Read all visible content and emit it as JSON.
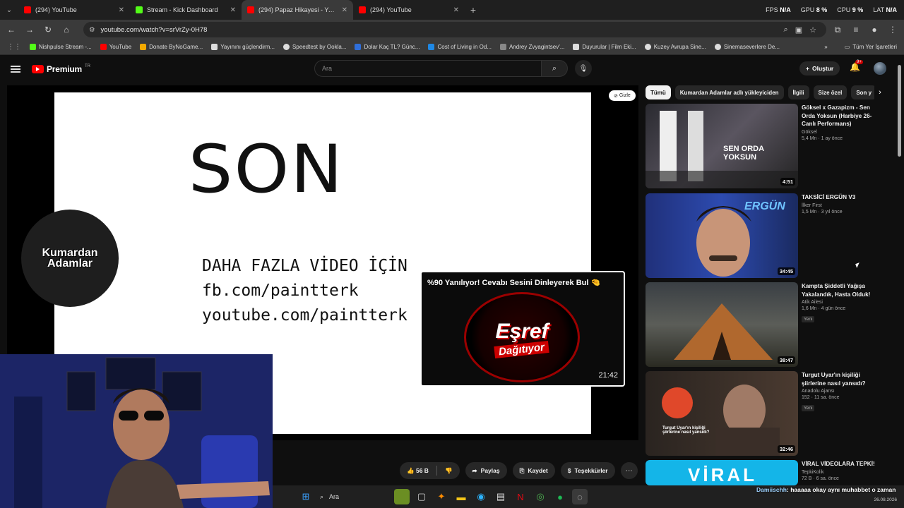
{
  "browser": {
    "tabs": [
      {
        "title": "(294) YouTube",
        "icon": "youtube-icon",
        "color": "#ff0000"
      },
      {
        "title": "Stream - Kick Dashboard",
        "icon": "kick-icon",
        "color": "#53fc18"
      },
      {
        "title": "(294) Papaz Hikayesi - YouTube",
        "icon": "youtube-icon",
        "color": "#ff0000",
        "active": true
      },
      {
        "title": "(294) YouTube",
        "icon": "youtube-icon",
        "color": "#ff0000"
      }
    ],
    "stats": {
      "fps_label": "FPS",
      "fps_value": "N/A",
      "gpu_label": "GPU",
      "gpu_value": "8 %",
      "cpu_label": "CPU",
      "cpu_value": "9 %",
      "lat_label": "LAT",
      "lat_value": "N/A"
    },
    "url": "youtube.com/watch?v=srVrZy-0H78",
    "bookmarks": [
      {
        "label": "Nishpulse Stream -...",
        "color": "#53fc18"
      },
      {
        "label": "YouTube",
        "color": "#ff0000"
      },
      {
        "label": "Donate ByNoGame...",
        "color": "#f2a900"
      },
      {
        "label": "Yayınını güçlendirm...",
        "color": "#dddddd"
      },
      {
        "label": "Speedtest by Ookla...",
        "color": "#dddddd"
      },
      {
        "label": "Dolar Kaç TL? Günc...",
        "color": "#2f6fdb"
      },
      {
        "label": "Cost of Living in Od...",
        "color": "#1e88e5"
      },
      {
        "label": "Andrey Zvyagintsev'...",
        "color": "#888888"
      },
      {
        "label": "Duyurular | Film Eki...",
        "color": "#dddddd"
      },
      {
        "label": "Kuzey Avrupa Sine...",
        "color": "#dddddd"
      },
      {
        "label": "Sinemaseverlere De...",
        "color": "#dddddd"
      }
    ],
    "all_bookmarks": "Tüm Yer İşaretleri"
  },
  "youtube": {
    "logo_text": "Premium",
    "logo_sup": "TR",
    "search_placeholder": "Ara",
    "create_label": "Oluştur",
    "notif_count": "9+",
    "gizle": "Gizle",
    "slide": {
      "big": "SON",
      "line1": "DAHA FAZLA VİDEO İÇİN",
      "line2": "fb.com/paintterk",
      "line3": "youtube.com/paintterk"
    },
    "channel_logo": {
      "line1": "Kumardan",
      "line2": "Adamlar"
    },
    "end_card": {
      "title": "%90 Yanılıyor! Cevabı Sesini Dinleyerek Bul",
      "thumb_line1": "Eşref",
      "thumb_line2": "Dağıtıyor",
      "duration": "21:42"
    },
    "actions": {
      "likes": "56 B",
      "share": "Paylaş",
      "save": "Kaydet",
      "thanks": "Teşekkürler"
    },
    "chips": [
      "Tümü",
      "Kumardan Adamlar adlı yükleyiciden",
      "İlgili",
      "Size özel",
      "Son y"
    ],
    "recommendations": [
      {
        "title": "Göksel x Gazapizm - Sen Orda Yoksun (Harbiye 26- Canlı Performans)",
        "channel": "Göksel",
        "stats": "5,4 Mn · 1 ay önce",
        "duration": "4:51",
        "badge": "",
        "thumb_text": "SEN ORDA YOKSUN"
      },
      {
        "title": "TAKSİCİ ERGÜN V3",
        "channel": "İlker First",
        "stats": "1,5 Mn · 3 yıl önce",
        "duration": "34:45",
        "badge": "",
        "thumb_text": "ERGÜN"
      },
      {
        "title": "Kampta Şiddetli Yağışa Yakalandık, Hasta Olduk!",
        "channel": "Atik Ailesi",
        "stats": "1,6 Mn · 4 gün önce",
        "duration": "38:47",
        "badge": "Yeni",
        "thumb_text": ""
      },
      {
        "title": "Turgut Uyar'ın kişiliği şiirlerine nasıl yansıdı?",
        "channel": "Anadolu Ajansı",
        "stats": "152 · 11 sa. önce",
        "duration": "32:46",
        "badge": "Yeni",
        "thumb_text": "Turgut Uyar'ın kişiliği şiirlerine nasıl yansıdı?"
      },
      {
        "title": "VİRAL VİDEOLARA TEPKİ!",
        "channel": "TepkiKolik",
        "stats": "72 B · 6 sa. önce",
        "duration": "",
        "badge": "",
        "thumb_text": "VİRAL"
      }
    ]
  },
  "taskbar": {
    "search": "Ara",
    "date": "26.08.2026"
  },
  "chat": {
    "name": "Damiischh",
    "message": ": haaaaa okay aynı muhabbet o zaman"
  }
}
